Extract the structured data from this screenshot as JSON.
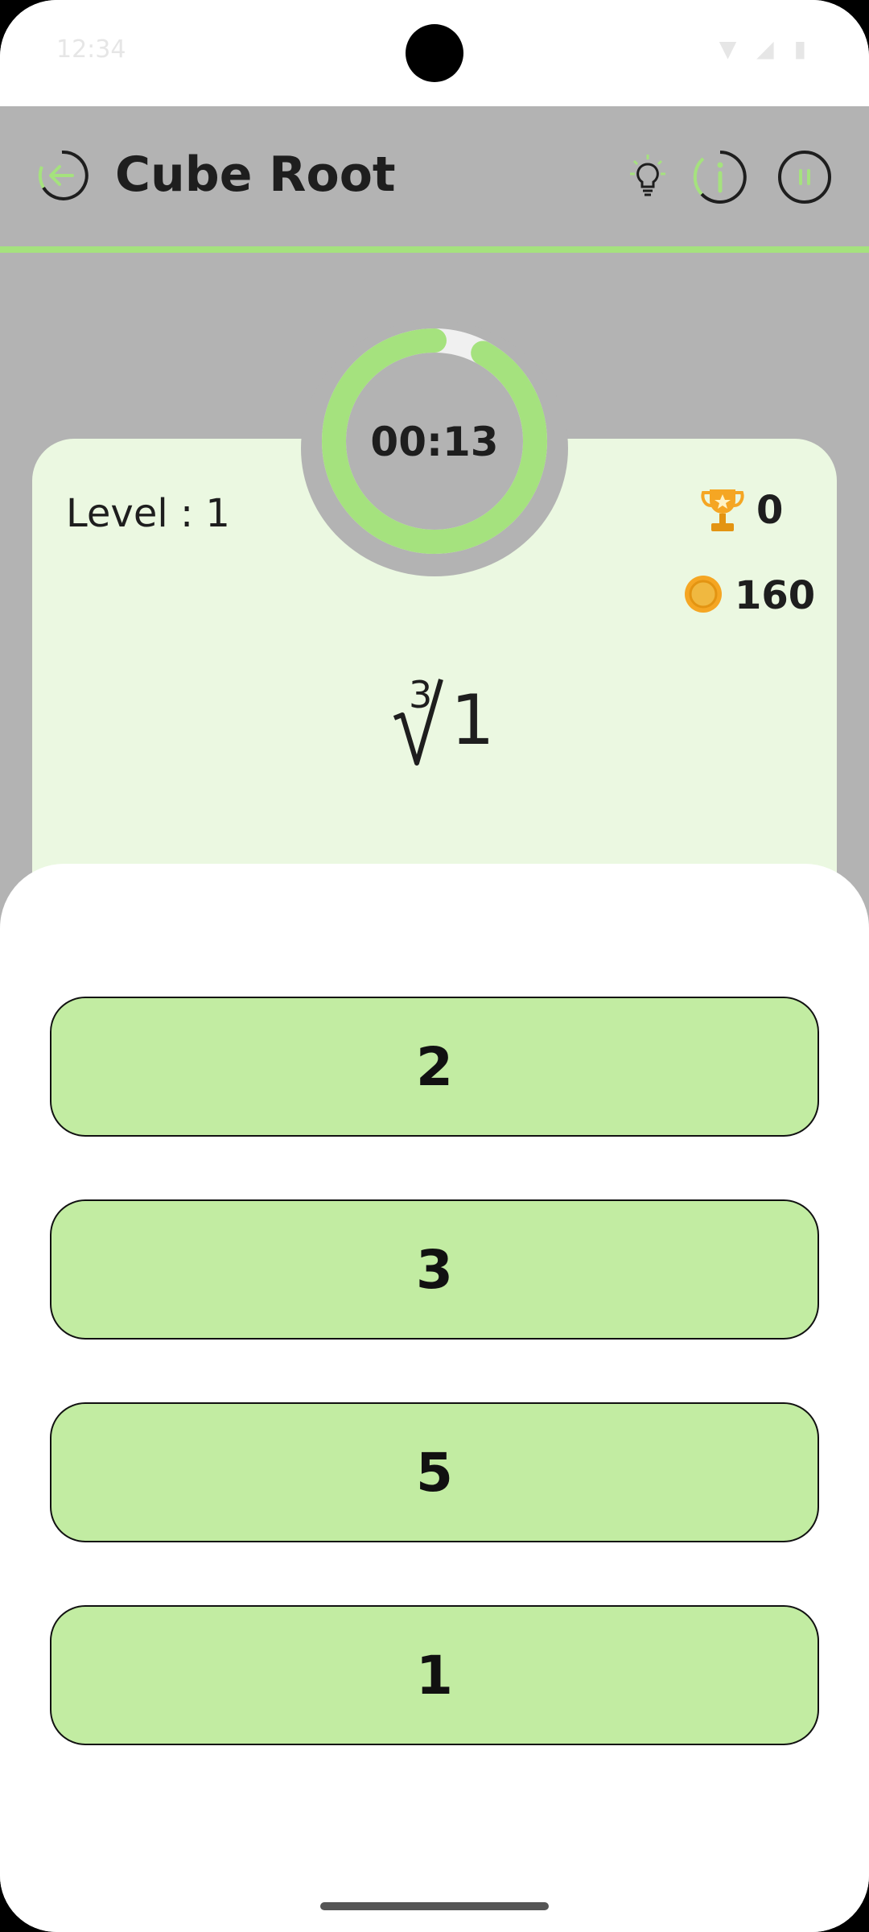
{
  "status_bar": {
    "time": "12:34",
    "icons": "▼ ◢ ▮"
  },
  "header": {
    "title": "Cube Root"
  },
  "colors": {
    "accent": "#a5e27e",
    "option_fill": "#c2eca2",
    "card_bg": "#ebf8e1",
    "app_bg": "#b3b3b3"
  },
  "timer": {
    "text": "00:13",
    "remaining_fraction": 0.92
  },
  "stats": {
    "level": "Level : 1",
    "trophies": "0",
    "coins": "160"
  },
  "question": {
    "index": "3",
    "radicand": "1"
  },
  "options": [
    "2",
    "3",
    "5",
    "1"
  ],
  "icons": {
    "back": "back-arrow-icon",
    "hint": "lightbulb-icon",
    "info": "info-icon",
    "pause": "pause-icon",
    "trophy": "trophy-icon",
    "coin": "coin-icon"
  }
}
